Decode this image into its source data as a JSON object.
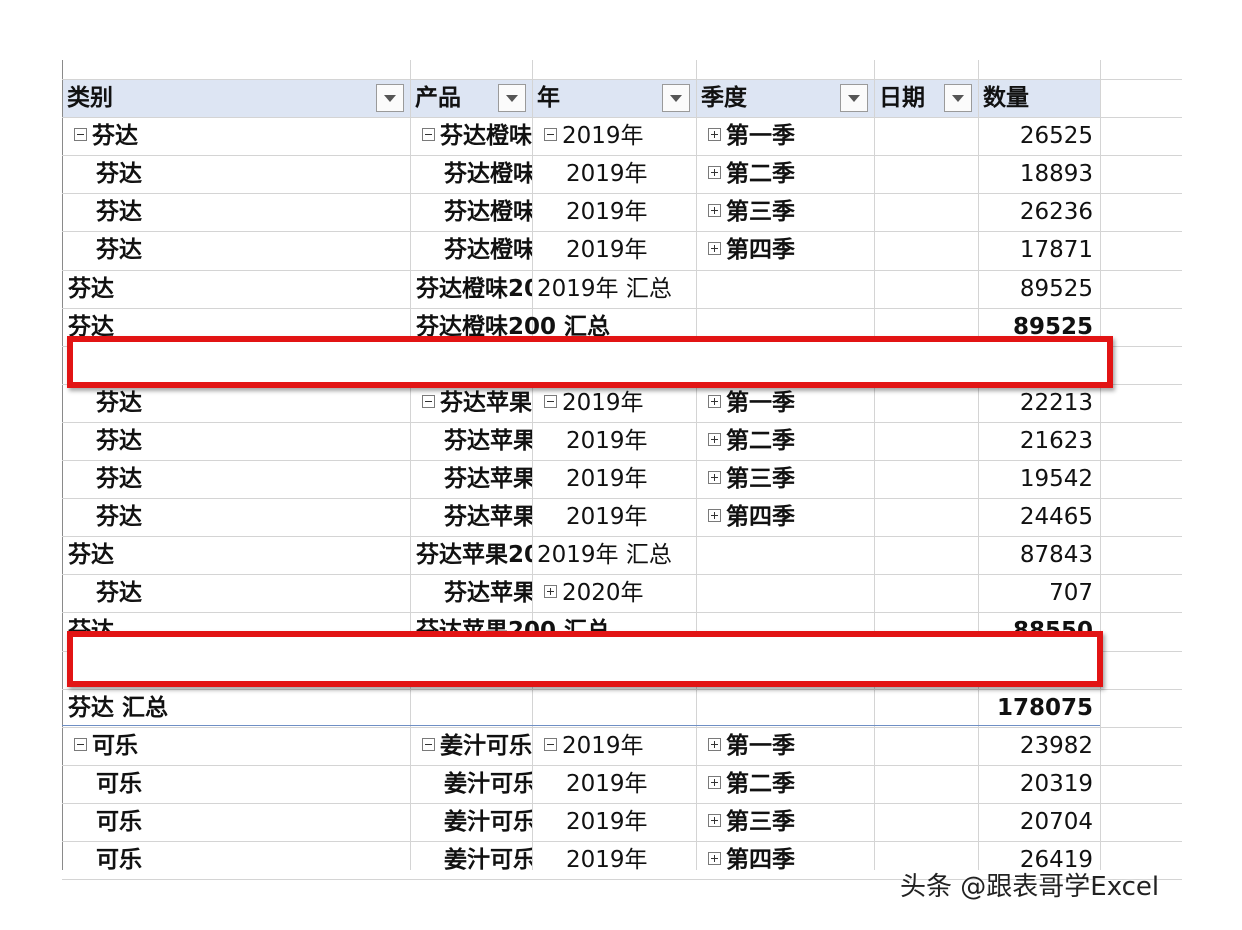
{
  "columns": [
    "类别",
    "产品",
    "年",
    "季度",
    "日期",
    "数量"
  ],
  "rows": [
    {
      "c0": "芬达",
      "c0_tog": "minus",
      "c0_bold": true,
      "c0_indent": false,
      "c1": "芬达橙味",
      "c1_tog": "minus",
      "c2": "2019年",
      "c2_tog": "minus",
      "c3": "第一季",
      "c3_tog": "plus",
      "c5": "26525"
    },
    {
      "c0": "芬达",
      "c0_bold": true,
      "c0_indent": true,
      "c1": "芬达橙味",
      "c2": "2019年",
      "c3": "第二季",
      "c3_tog": "plus",
      "c5": "18893"
    },
    {
      "c0": "芬达",
      "c0_bold": true,
      "c0_indent": true,
      "c1": "芬达橙味",
      "c2": "2019年",
      "c3": "第三季",
      "c3_tog": "plus",
      "c5": "26236"
    },
    {
      "c0": "芬达",
      "c0_bold": true,
      "c0_indent": true,
      "c1": "芬达橙味",
      "c2": "2019年",
      "c3": "第四季",
      "c3_tog": "plus",
      "c5": "17871"
    },
    {
      "c0": "芬达",
      "c0_bold": true,
      "c1": "芬达橙味20",
      "c1_bold": true,
      "c1_flush": true,
      "c2": "2019年 汇总",
      "c2_flush": true,
      "c5": "89525"
    },
    {
      "c0": "芬达",
      "c0_bold": true,
      "c1": "芬达橙味200 汇总",
      "c1_bold": true,
      "c1_flush": true,
      "c1_wide": true,
      "c5": "89525",
      "c5_bold": true
    },
    {
      "blank": true
    },
    {
      "c0": "芬达",
      "c0_bold": true,
      "c0_indent": true,
      "c1": "芬达苹果",
      "c1_tog": "minus",
      "c2": "2019年",
      "c2_tog": "minus",
      "c3": "第一季",
      "c3_tog": "plus",
      "c5": "22213"
    },
    {
      "c0": "芬达",
      "c0_bold": true,
      "c0_indent": true,
      "c1": "芬达苹果",
      "c2": "2019年",
      "c3": "第二季",
      "c3_tog": "plus",
      "c5": "21623"
    },
    {
      "c0": "芬达",
      "c0_bold": true,
      "c0_indent": true,
      "c1": "芬达苹果",
      "c2": "2019年",
      "c3": "第三季",
      "c3_tog": "plus",
      "c5": "19542"
    },
    {
      "c0": "芬达",
      "c0_bold": true,
      "c0_indent": true,
      "c1": "芬达苹果",
      "c2": "2019年",
      "c3": "第四季",
      "c3_tog": "plus",
      "c5": "24465"
    },
    {
      "c0": "芬达",
      "c0_bold": true,
      "c1": "芬达苹果20",
      "c1_bold": true,
      "c1_flush": true,
      "c2": "2019年 汇总",
      "c2_flush": true,
      "c5": "87843"
    },
    {
      "c0": "芬达",
      "c0_bold": true,
      "c0_indent": true,
      "c1": "芬达苹果",
      "c2": "2020年",
      "c2_tog": "plus",
      "c5": "707"
    },
    {
      "c0": "芬达",
      "c0_bold": true,
      "c1": "芬达苹果200 汇总",
      "c1_bold": true,
      "c1_flush": true,
      "c1_wide": true,
      "c5": "88550",
      "c5_bold": true
    },
    {
      "blank": true
    },
    {
      "c0": "芬达 汇总",
      "c0_bold": true,
      "c5": "178075",
      "c5_bold": true
    },
    {
      "c0": "可乐",
      "c0_tog": "minus",
      "c0_bold": true,
      "c1": "姜汁可乐",
      "c1_tog": "minus",
      "c2": "2019年",
      "c2_tog": "minus",
      "c3": "第一季",
      "c3_tog": "plus",
      "c5": "23982"
    },
    {
      "c0": "可乐",
      "c0_bold": true,
      "c0_indent": true,
      "c1": "姜汁可乐",
      "c2": "2019年",
      "c3": "第二季",
      "c3_tog": "plus",
      "c5": "20319"
    },
    {
      "c0": "可乐",
      "c0_bold": true,
      "c0_indent": true,
      "c1": "姜汁可乐",
      "c2": "2019年",
      "c3": "第三季",
      "c3_tog": "plus",
      "c5": "20704"
    },
    {
      "c0": "可乐",
      "c0_bold": true,
      "c0_indent": true,
      "c1": "姜汁可乐",
      "c2": "2019年",
      "c3": "第四季",
      "c3_tog": "plus",
      "c5": "26419"
    }
  ],
  "watermark": "头条 @跟表哥学Excel",
  "colors": {
    "header_bg": "#dde5f3",
    "highlight_border": "#e21414"
  },
  "icons": {
    "filter": "dropdown-arrow-icon",
    "expand": "plus-box-icon",
    "collapse": "minus-box-icon"
  }
}
